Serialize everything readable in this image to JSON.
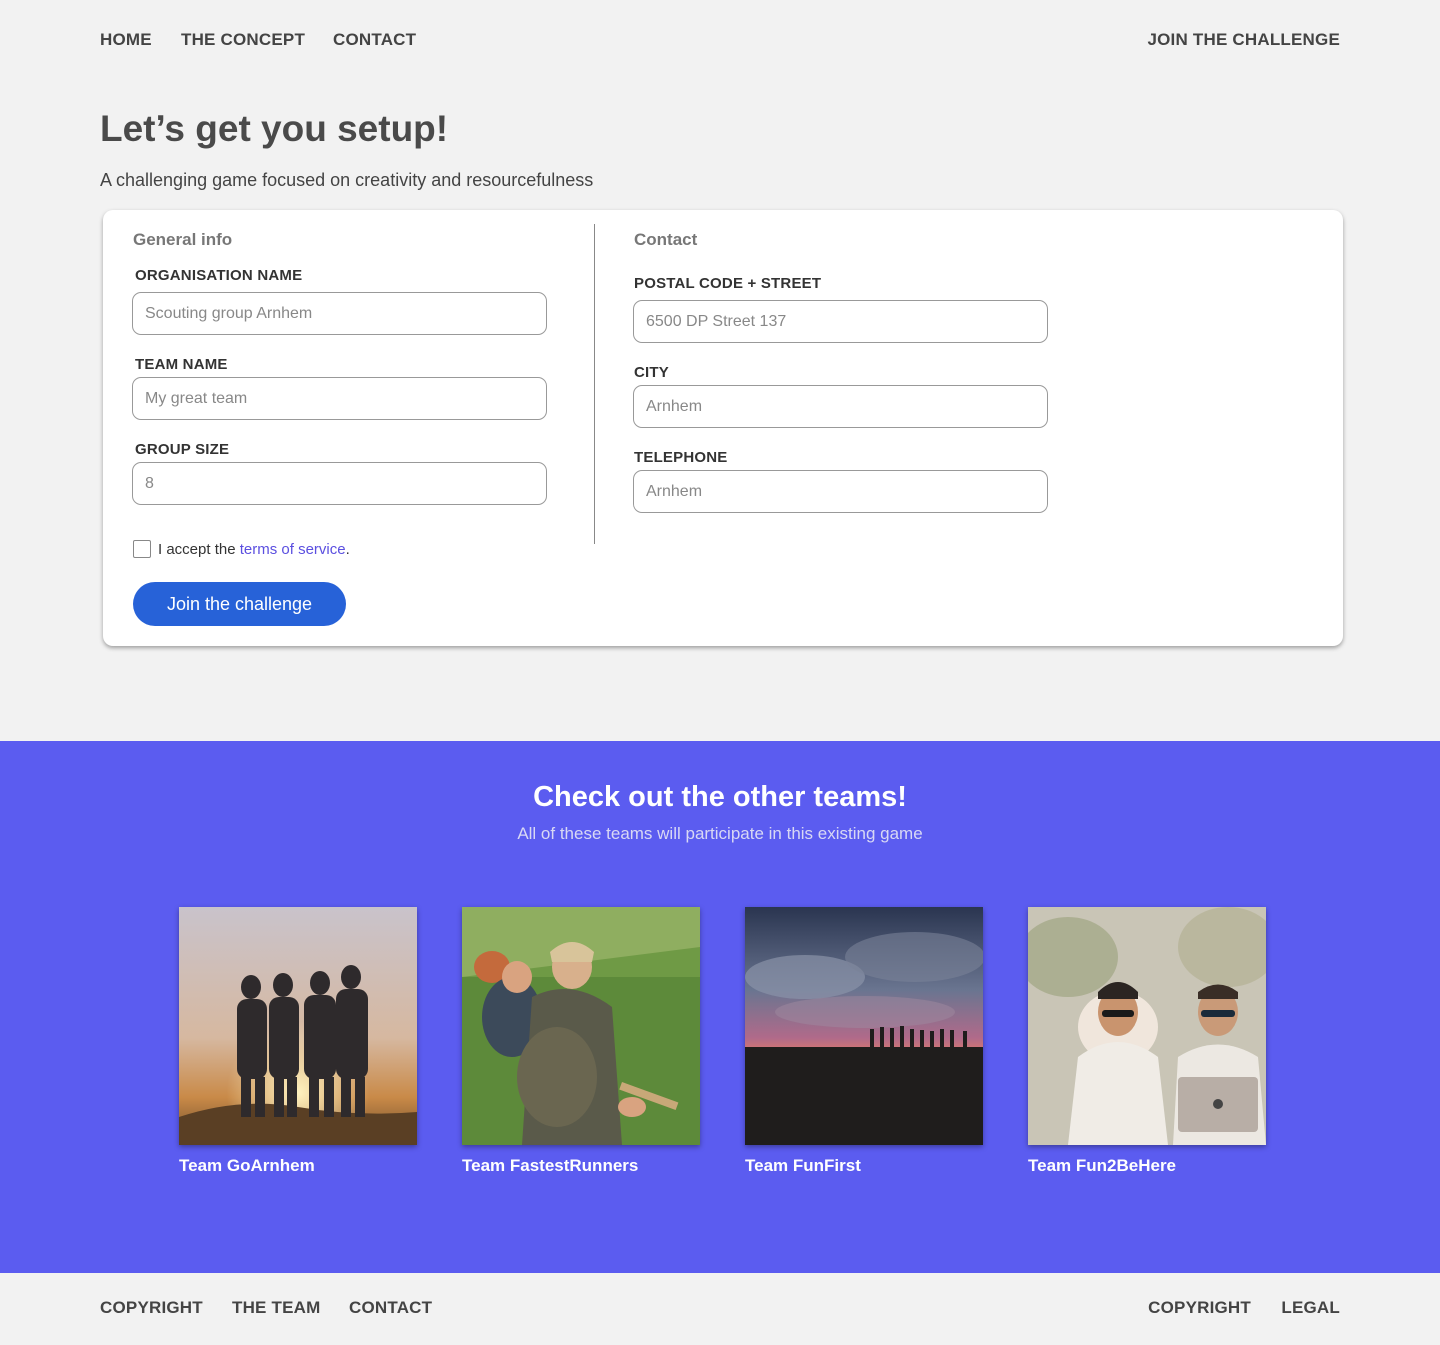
{
  "nav": {
    "home": "HOME",
    "concept": "THE CONCEPT",
    "contact": "CONTACT",
    "join": "JOIN THE CHALLENGE"
  },
  "hero": {
    "title": "Let’s get you setup!",
    "subtitle": "A challenging game focused on creativity and resourcefulness"
  },
  "form": {
    "general_title": "General info",
    "contact_title": "Contact",
    "org_label": "ORGANISATION NAME",
    "org_placeholder": "Scouting group Arnhem",
    "team_label": "TEAM NAME",
    "team_placeholder": "My great team",
    "size_label": "GROUP SIZE",
    "size_placeholder": "8",
    "postal_label": "POSTAL CODE + STREET",
    "postal_placeholder": "6500 DP Street 137",
    "city_label": "CITY",
    "city_placeholder": "Arnhem",
    "phone_label": "TELEPHONE",
    "phone_placeholder": "Arnhem",
    "accept_text": "I accept the",
    "terms_link": "terms of service",
    "terms_dot": ".",
    "submit_label": "Join the challenge"
  },
  "teams": {
    "title": "Check out the other teams!",
    "subtitle": "All of these teams will participate in this existing game",
    "items": [
      {
        "name": "Team GoArnhem"
      },
      {
        "name": "Team FastestRunners"
      },
      {
        "name": "Team FunFirst"
      },
      {
        "name": "Team Fun2BeHere"
      }
    ]
  },
  "footer": {
    "copyright": "COPYRIGHT",
    "team": "THE TEAM",
    "contact": "CONTACT",
    "copyright_right": "COPYRIGHT",
    "legal": "LEGAL"
  },
  "colors": {
    "accent_button": "#2762d8",
    "teams_background": "#5b5cf0",
    "link": "#5b4fe0"
  }
}
